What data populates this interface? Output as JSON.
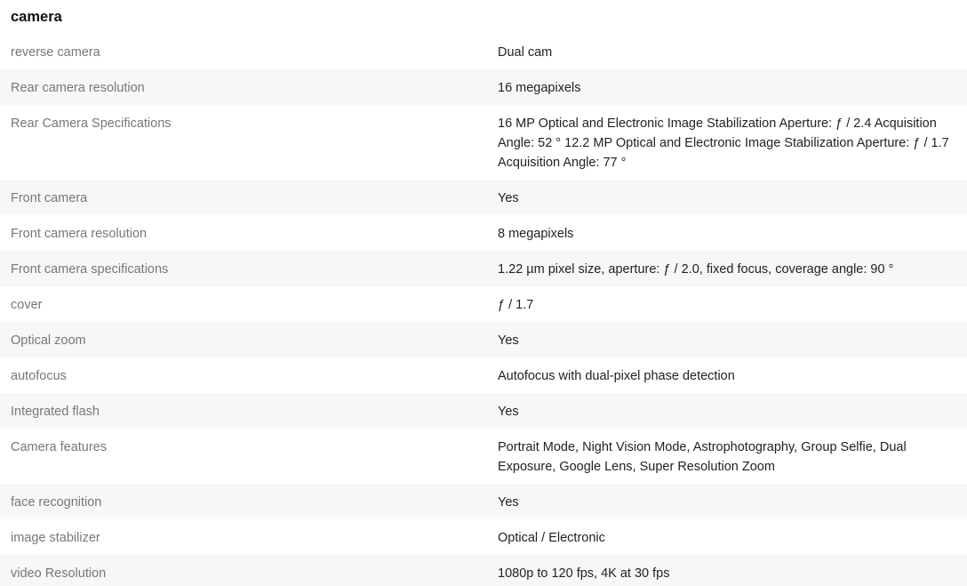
{
  "section": {
    "title": "camera"
  },
  "rows": [
    {
      "label": "reverse camera",
      "value": "Dual cam"
    },
    {
      "label": "Rear camera resolution",
      "value": "16 megapixels"
    },
    {
      "label": "Rear Camera Specifications",
      "value": "16 MP Optical and Electronic Image Stabilization Aperture: ƒ / 2.4 Acquisition Angle: 52 ° 12.2 MP Optical and Electronic Image Stabilization Aperture: ƒ / 1.7 Acquisition Angle: 77 °"
    },
    {
      "label": "Front camera",
      "value": "Yes"
    },
    {
      "label": "Front camera resolution",
      "value": "8 megapixels"
    },
    {
      "label": "Front camera specifications",
      "value": "1.22 µm pixel size, aperture: ƒ / 2.0, fixed focus, coverage angle: 90 °"
    },
    {
      "label": "cover",
      "value": "ƒ / 1.7"
    },
    {
      "label": "Optical zoom",
      "value": "Yes"
    },
    {
      "label": "autofocus",
      "value": "Autofocus with dual-pixel phase detection"
    },
    {
      "label": "Integrated flash",
      "value": "Yes"
    },
    {
      "label": "Camera features",
      "value": "Portrait Mode, Night Vision Mode, Astrophotography, Group Selfie, Dual Exposure, Google Lens, Super Resolution Zoom"
    },
    {
      "label": "face recognition",
      "value": "Yes"
    },
    {
      "label": "image stabilizer",
      "value": "Optical / Electronic"
    },
    {
      "label": "video Resolution",
      "value": "1080p to 120 fps, 4K at 30 fps"
    }
  ]
}
